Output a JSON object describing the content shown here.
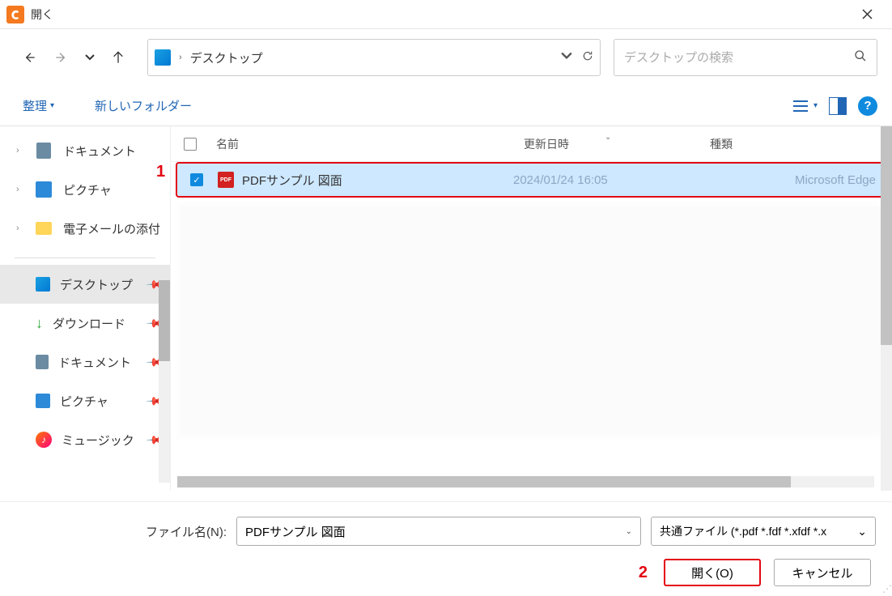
{
  "titlebar": {
    "title": "開く"
  },
  "addressbar": {
    "location": "デスクトップ"
  },
  "searchbox": {
    "placeholder": "デスクトップの検索"
  },
  "toolbar": {
    "organize": "整理",
    "new_folder": "新しいフォルダー",
    "help": "?"
  },
  "sidebar": {
    "tree": [
      {
        "label": "ドキュメント",
        "icon": "doc"
      },
      {
        "label": "ピクチャ",
        "icon": "pic"
      },
      {
        "label": "電子メールの添付",
        "icon": "folder"
      }
    ],
    "quick": [
      {
        "label": "デスクトップ",
        "icon": "desktop",
        "selected": true
      },
      {
        "label": "ダウンロード",
        "icon": "download"
      },
      {
        "label": "ドキュメント",
        "icon": "doc"
      },
      {
        "label": "ピクチャ",
        "icon": "pic"
      },
      {
        "label": "ミュージック",
        "icon": "music"
      }
    ]
  },
  "columns": {
    "name": "名前",
    "date": "更新日時",
    "type": "種類"
  },
  "files": [
    {
      "name": "PDFサンプル 図面",
      "date": "2024/01/24 16:05",
      "type": "Microsoft Edge",
      "selected": true
    }
  ],
  "footer": {
    "filename_label": "ファイル名(N):",
    "filename_value": "PDFサンプル 図面",
    "filetype_value": "共通ファイル (*.pdf *.fdf *.xfdf *.x",
    "open": "開く(O)",
    "cancel": "キャンセル"
  },
  "annotations": {
    "a1": "1",
    "a2": "2"
  }
}
